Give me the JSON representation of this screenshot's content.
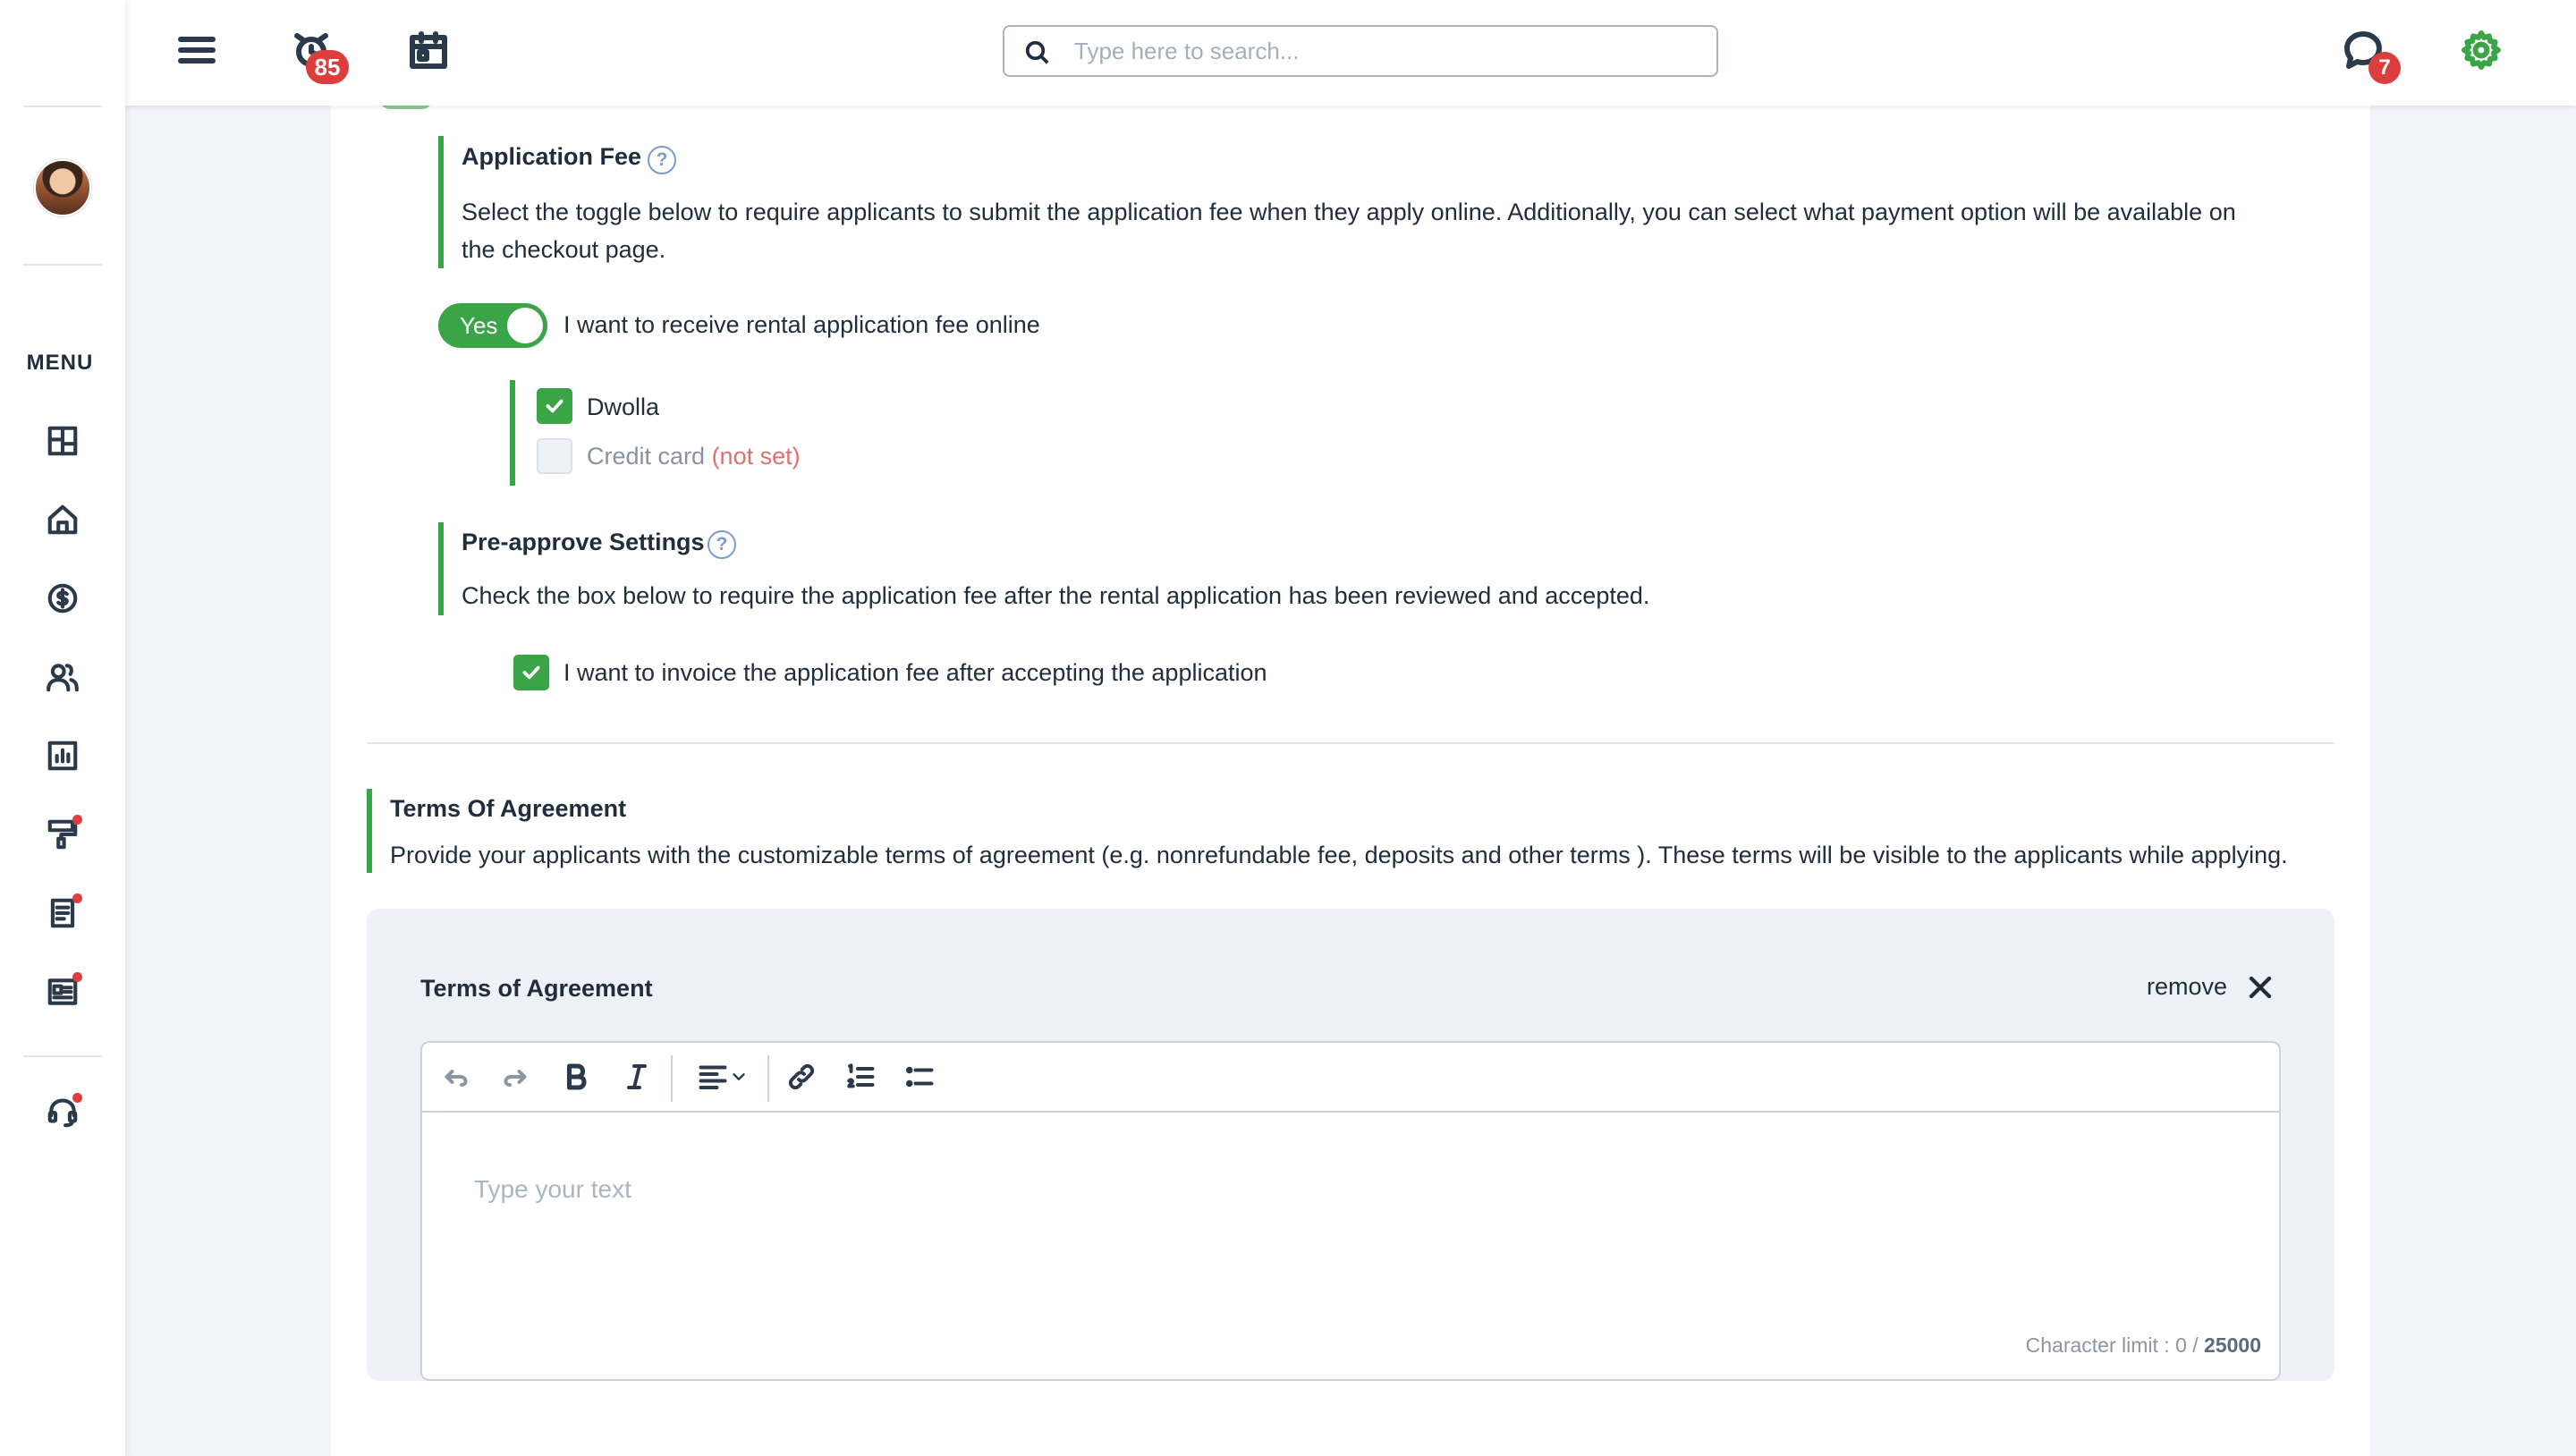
{
  "header": {
    "alarm_badge": "85",
    "search_placeholder": "Type here to search...",
    "chat_badge": "7"
  },
  "sidebar": {
    "menu_label": "MENU",
    "items": [
      {
        "icon": "dashboard-icon"
      },
      {
        "icon": "home-icon"
      },
      {
        "icon": "dollar-icon"
      },
      {
        "icon": "users-icon"
      },
      {
        "icon": "reports-icon"
      },
      {
        "icon": "maintenance-icon",
        "dot": true
      },
      {
        "icon": "document-icon",
        "dot": true
      },
      {
        "icon": "newsletter-icon",
        "dot": true
      },
      {
        "icon": "support-icon",
        "dot": true
      }
    ]
  },
  "application_fee": {
    "title": "Application Fee",
    "description_line1": "Select the toggle below to require applicants to submit the application fee when they apply online. Additionally, you can select what payment option will be available on",
    "description_line2": "the checkout page.",
    "toggle_label": "Yes",
    "toggle_text": "I want to receive rental application fee online",
    "toggle_on": true,
    "options": [
      {
        "label": "Dwolla",
        "checked": true,
        "suffix": ""
      },
      {
        "label": "Credit card",
        "checked": false,
        "suffix": "(not set)"
      }
    ]
  },
  "pre_approve": {
    "title": "Pre-approve Settings",
    "description": "Check the box below to require the application fee after the rental application has been reviewed and accepted.",
    "checkbox_label": "I want to invoice the application fee after accepting the application",
    "checked": true
  },
  "terms": {
    "title": "Terms Of Agreement",
    "description": "Provide your applicants with the customizable terms of agreement (e.g. nonrefundable fee, deposits and other terms ). These terms will be visible to the applicants while applying.",
    "panel_title": "Terms of Agreement",
    "remove_label": "remove",
    "editor_placeholder": "Type your text",
    "char_limit_label": "Character limit : 0 /",
    "char_limit_max": "25000"
  },
  "colors": {
    "accent_green": "#3aa547",
    "badge_red": "#dc3d3d"
  }
}
